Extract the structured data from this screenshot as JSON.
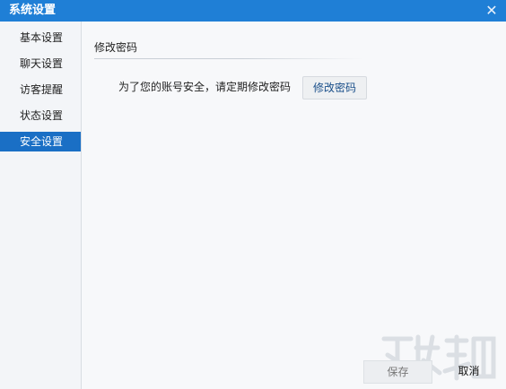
{
  "window": {
    "title": "系统设置",
    "close_glyph": "✕"
  },
  "sidebar": {
    "items": [
      {
        "label": "基本设置"
      },
      {
        "label": "聊天设置"
      },
      {
        "label": "访客提醒"
      },
      {
        "label": "状态设置"
      },
      {
        "label": "安全设置",
        "active": true
      }
    ]
  },
  "main": {
    "section_title": "修改密码",
    "hint": "为了您的账号安全，请定期修改密码",
    "change_password_button": "修改密码"
  },
  "footer": {
    "save_label": "保存",
    "cancel_label": "取消"
  },
  "colors": {
    "titlebar": "#1f7fd6",
    "active_item": "#1a6fc5"
  }
}
